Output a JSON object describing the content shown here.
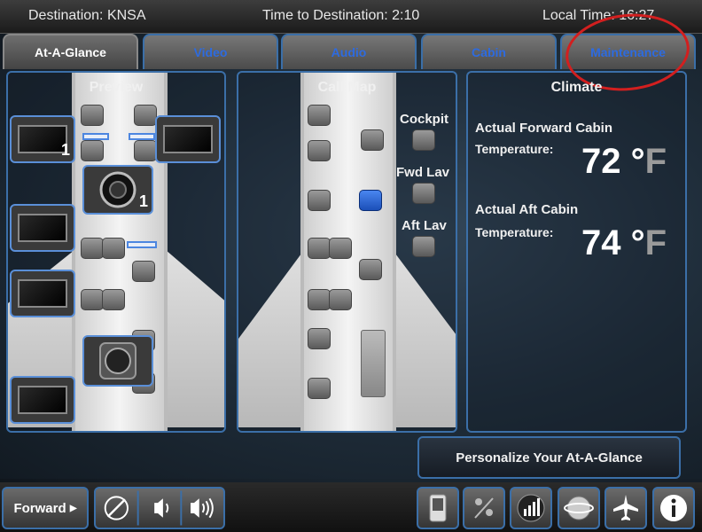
{
  "status": {
    "destination": "Destination: KNSA",
    "time_to_destination": "Time to Destination: 2:10",
    "local_time": "Local Time: 16:27"
  },
  "tabs": [
    {
      "label": "At-A-Glance",
      "active": true
    },
    {
      "label": "Video",
      "active": false
    },
    {
      "label": "Audio",
      "active": false
    },
    {
      "label": "Cabin",
      "active": false
    },
    {
      "label": "Maintenance",
      "active": false
    }
  ],
  "preview": {
    "title": "Preview",
    "camera_numbers": [
      "1",
      "1"
    ]
  },
  "call_map": {
    "title": "Call Map",
    "labels": [
      "Cockpit",
      "Fwd Lav",
      "Aft Lav"
    ]
  },
  "climate": {
    "title": "Climate",
    "forward_label_1": "Actual Forward Cabin",
    "forward_label_2": "Temperature:",
    "forward_value": "72",
    "aft_label_1": "Actual Aft Cabin",
    "aft_label_2": "Temperature:",
    "aft_value": "74",
    "degree": "°",
    "unit": "F"
  },
  "personalize_label": "Personalize Your At-A-Glance",
  "bottom": {
    "forward_label": "Forward",
    "forward_arrow": "▶",
    "icons": [
      "mute-icon",
      "volume-down-icon",
      "volume-up-icon",
      "phone-icon",
      "lighting-icon",
      "signal-icon",
      "globe-icon",
      "airplane-icon",
      "info-icon"
    ]
  },
  "colors": {
    "accent": "#3b6fa8",
    "tab_text": "#2d6be0",
    "highlight_circle": "#d21f1f",
    "active_seat": "#2f6ae0"
  }
}
